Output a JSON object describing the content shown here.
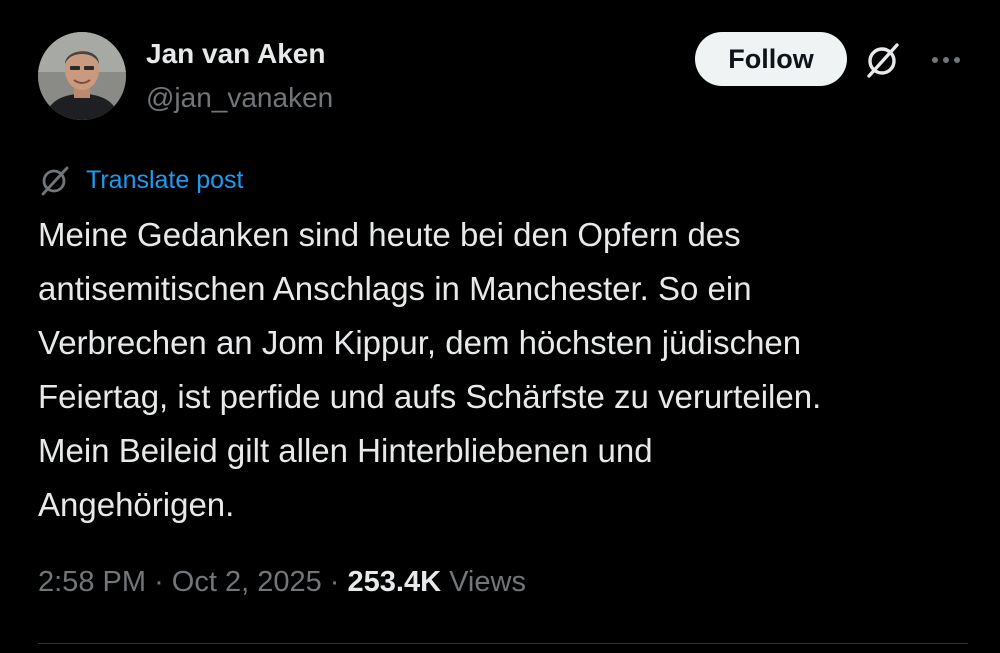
{
  "author": {
    "display_name": "Jan van Aken",
    "handle": "@jan_vanaken",
    "avatar_icon": "person-photo-avatar"
  },
  "actions": {
    "follow_label": "Follow",
    "grok_icon": "grok-slash-circle-icon",
    "more_icon": "more-horizontal-icon"
  },
  "translate": {
    "label": "Translate post",
    "icon": "grok-slash-circle-icon"
  },
  "post": {
    "text": "Meine Gedanken sind heute bei den Opfern des\nantisemitischen Anschlags in Manchester. So ein\nVerbrechen an Jom Kippur, dem höchsten jüdischen\nFeiertag, ist perfide und aufs Schärfste zu verurteilen.\nMein Beileid gilt allen Hinterbliebenen und\nAngehörigen."
  },
  "meta": {
    "time": "2:58 PM",
    "separator": "·",
    "date": "Oct 2, 2025",
    "views_count": "253.4K",
    "views_label": "Views"
  },
  "colors": {
    "background": "#000000",
    "text_primary": "#e7e9ea",
    "text_secondary": "#71767b",
    "link": "#1d9bf0",
    "follow_bg": "#eff3f4",
    "divider": "#2f3336"
  }
}
